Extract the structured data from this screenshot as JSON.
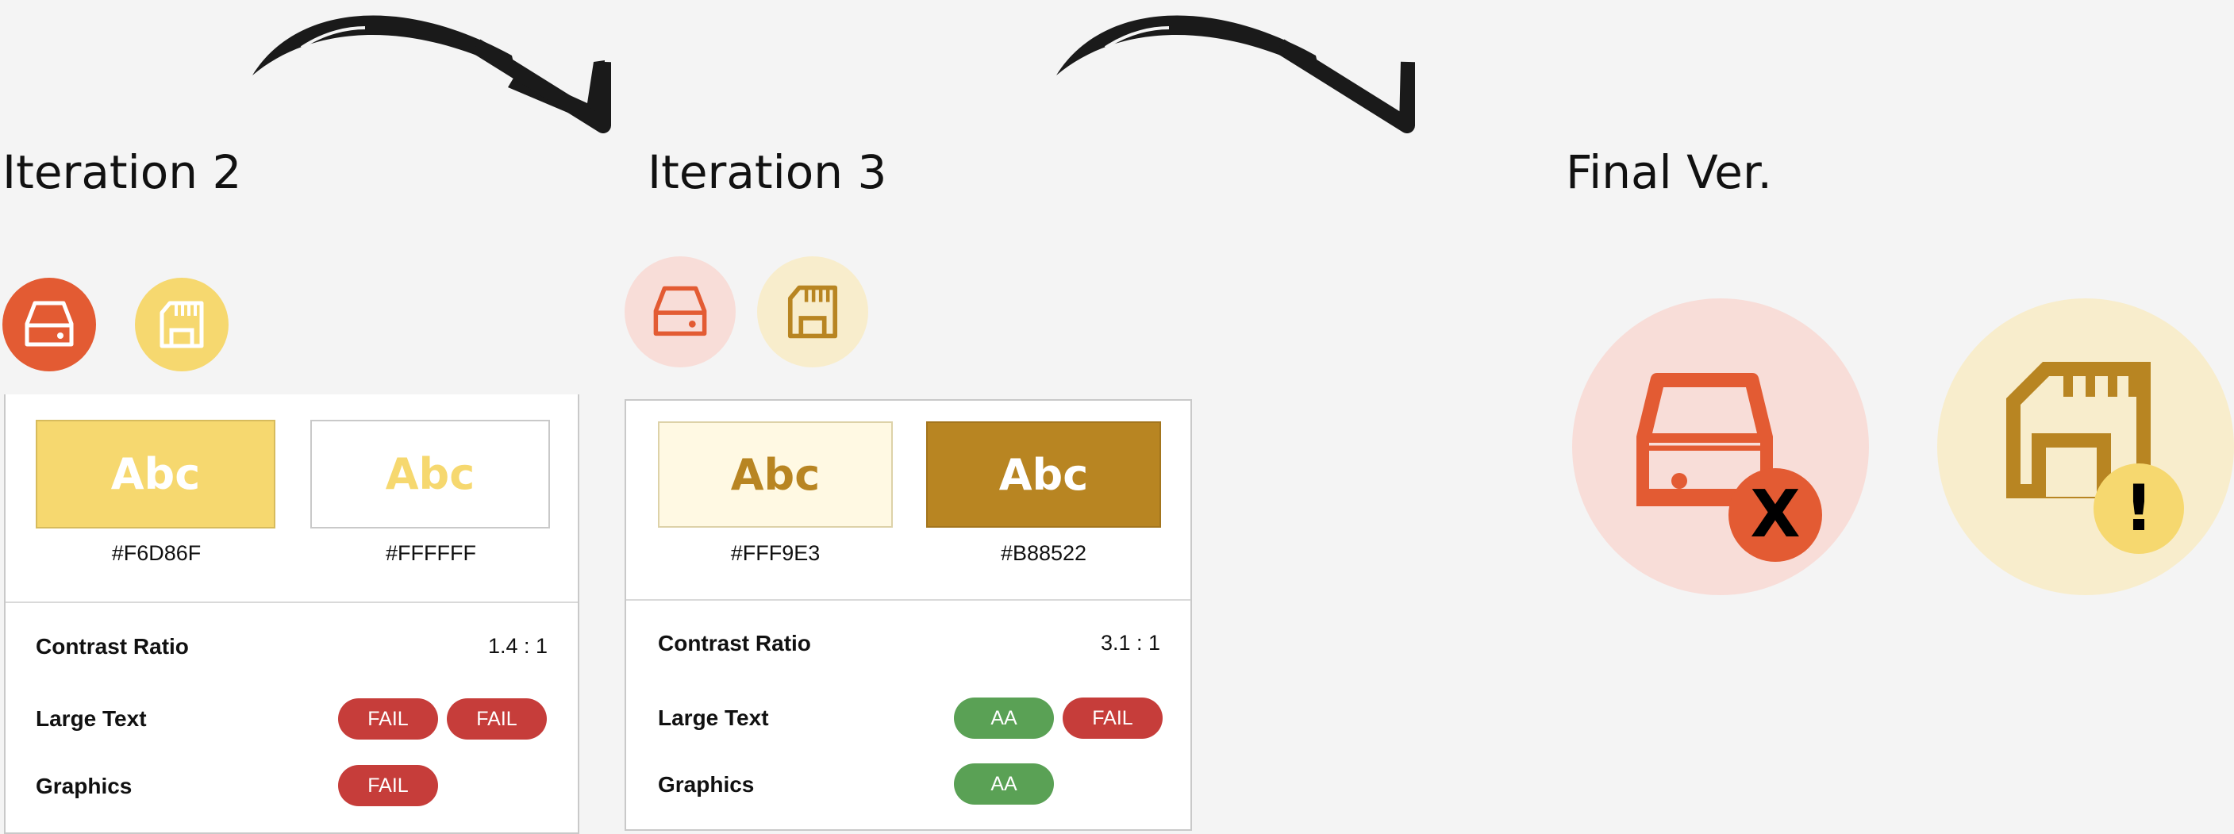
{
  "headings": {
    "iteration2": "Iteration 2",
    "iteration3": "Iteration 3",
    "final": "Final Ver."
  },
  "icons": {
    "iteration2_drive": "hard-drive-icon",
    "iteration2_card": "sd-card-icon",
    "iteration3_drive": "hard-drive-icon",
    "iteration3_card": "sd-card-icon",
    "final_drive": "hard-drive-error-icon",
    "final_card": "sd-card-warning-icon"
  },
  "colors": {
    "orange": "#E35B33",
    "yellow": "#F6D86F",
    "light_pink": "#F8DDD8",
    "light_yellow": "#F8EDCC",
    "cream": "#FFF9E3",
    "white": "#FFFFFF",
    "gold": "#B88522",
    "pass_green": "#5AA155",
    "fail_red": "#C63D3A"
  },
  "iteration2_card": {
    "swatch1_text": "Abc",
    "swatch1_hex": "#F6D86F",
    "swatch2_text": "Abc",
    "swatch2_hex": "#FFFFFF",
    "contrast_label": "Contrast Ratio",
    "contrast_value": "1.4 : 1",
    "large_text_label": "Large Text",
    "large_text_badges": [
      "FAIL",
      "FAIL"
    ],
    "graphics_label": "Graphics",
    "graphics_badges": [
      "FAIL"
    ]
  },
  "iteration3_card": {
    "swatch1_text": "Abc",
    "swatch1_hex": "#FFF9E3",
    "swatch2_text": "Abc",
    "swatch2_hex": "#B88522",
    "contrast_label": "Contrast Ratio",
    "contrast_value": "3.1 : 1",
    "large_text_label": "Large Text",
    "large_text_badges": [
      "AA",
      "FAIL"
    ],
    "graphics_label": "Graphics",
    "graphics_badges": [
      "AA"
    ]
  },
  "final_badges": {
    "error_mark": "X",
    "warning_mark": "!"
  }
}
